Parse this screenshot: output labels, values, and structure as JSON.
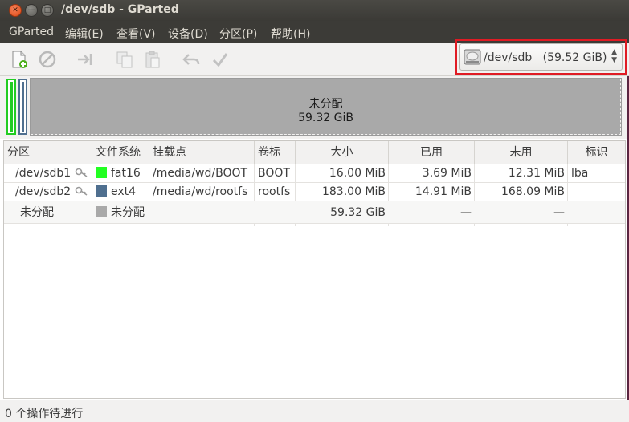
{
  "window": {
    "title": "/dev/sdb - GParted",
    "close_glyph": "✕",
    "min_glyph": "—",
    "max_glyph": "□"
  },
  "menu": [
    {
      "label": "GParted"
    },
    {
      "label": "编辑(E)"
    },
    {
      "label": "查看(V)"
    },
    {
      "label": "设备(D)"
    },
    {
      "label": "分区(P)"
    },
    {
      "label": "帮助(H)"
    }
  ],
  "toolbar": {
    "icons": [
      "new-partition-icon",
      "delete-icon",
      "resize-move-icon",
      "copy-icon",
      "paste-icon",
      "undo-icon",
      "apply-icon"
    ],
    "device_combo": {
      "device": "/dev/sdb",
      "size": "(59.52 GiB)"
    }
  },
  "diskmap": {
    "unallocated_label": "未分配",
    "unallocated_size": "59.32 GiB",
    "colors": {
      "fat16": "#22cc22",
      "ext4": "#4f6f8f",
      "unallocated": "#a9a9a9"
    }
  },
  "table": {
    "headers": [
      "分区",
      "文件系统",
      "挂载点",
      "卷标",
      "大小",
      "已用",
      "未用",
      "标识"
    ],
    "rows": [
      {
        "partition": "/dev/sdb1",
        "fs": "fat16",
        "fs_color": "#22ff22",
        "mount": "/media/wd/BOOT",
        "label": "BOOT",
        "size": "16.00 MiB",
        "used": "3.69 MiB",
        "unused": "12.31 MiB",
        "flags": "lba",
        "mounted": true
      },
      {
        "partition": "/dev/sdb2",
        "fs": "ext4",
        "fs_color": "#4f6f8f",
        "mount": "/media/wd/rootfs",
        "label": "rootfs",
        "size": "183.00 MiB",
        "used": "14.91 MiB",
        "unused": "168.09 MiB",
        "flags": "",
        "mounted": true
      },
      {
        "partition": "未分配",
        "fs": "未分配",
        "fs_color": "#a9a9a9",
        "mount": "",
        "label": "",
        "size": "59.32 GiB",
        "used": "—",
        "unused": "—",
        "flags": "",
        "mounted": false
      }
    ]
  },
  "status": {
    "text": "0 个操作待进行"
  }
}
